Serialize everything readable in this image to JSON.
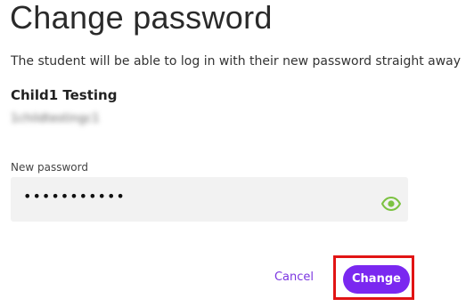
{
  "dialog": {
    "title": "Change password",
    "description": "The student will be able to log in with their new password straight away"
  },
  "student": {
    "name": "Child1 Testing",
    "username": "1childtestingc1"
  },
  "password_field": {
    "label": "New password",
    "value": "•••••••••••"
  },
  "icons": {
    "visibility_toggle": "eye-icon"
  },
  "actions": {
    "cancel_label": "Cancel",
    "change_label": "Change"
  },
  "colors": {
    "accent": "#7a28f0",
    "eye_icon": "#7cc242",
    "highlight_border": "#e11414",
    "field_background": "#f2f2f2"
  }
}
